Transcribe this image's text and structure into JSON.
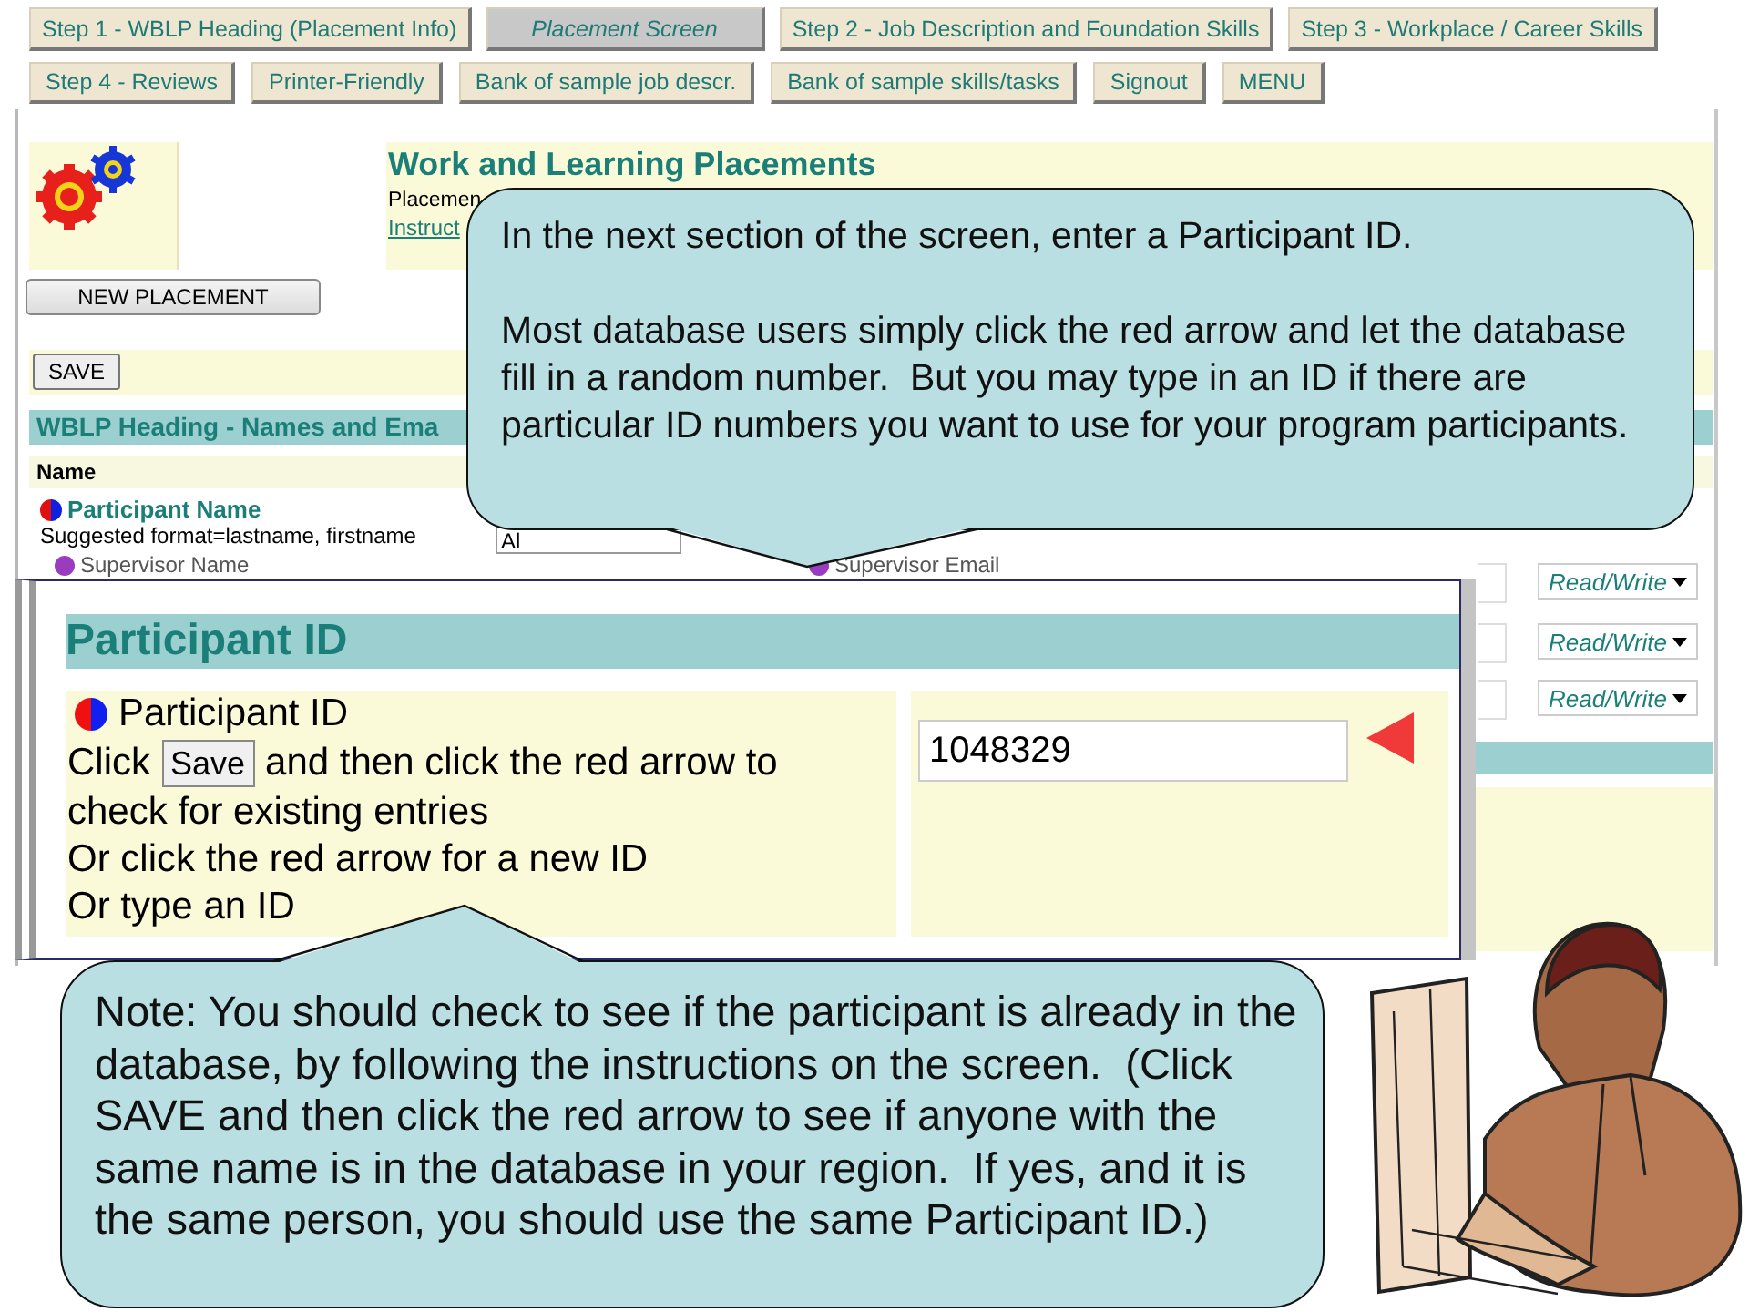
{
  "nav_rows": [
    [
      {
        "label": "Step 1 - WBLP Heading (Placement Info)",
        "selected": false
      },
      {
        "label": "Placement Screen",
        "selected": true
      },
      {
        "label": "Step 2 - Job Description and Foundation Skills",
        "selected": false
      },
      {
        "label": "Step 3 - Workplace / Career Skills",
        "selected": false
      }
    ],
    [
      {
        "label": "Step 4 - Reviews",
        "selected": false
      },
      {
        "label": "Printer-Friendly",
        "selected": false
      },
      {
        "label": "Bank of sample job descr.",
        "selected": false
      },
      {
        "label": "Bank of sample skills/tasks",
        "selected": false
      },
      {
        "label": "Signout",
        "selected": false
      },
      {
        "label": "MENU",
        "selected": false
      }
    ]
  ],
  "header": {
    "title": "Work and Learning Placements",
    "subtitle": "Placemen",
    "link": "Instruct"
  },
  "new_placement_button": "NEW PLACEMENT",
  "save_button": "SAVE",
  "section_heading": "WBLP Heading - Names and Ema",
  "name_column": "Name",
  "participant_name": {
    "label": "Participant Name",
    "hint": "Suggested format=lastname, firstname",
    "value": "Al"
  },
  "supervisor_labels": [
    "Supervisor Name",
    "Supervisor Email"
  ],
  "access_dropdowns": [
    "Read/Write",
    "Read/Write",
    "Read/Write"
  ],
  "inset": {
    "heading": "Participant ID",
    "label": "Participant ID",
    "before": "Click",
    "inline_button": "Save",
    "after": "and then click the red arrow to",
    "lines": [
      "check for existing entries",
      "Or click the red arrow for a new ID",
      "Or type an ID"
    ],
    "id_value": "1048329"
  },
  "callouts": [
    {
      "paragraphs": [
        "In the next section of the screen, enter a Participant ID.",
        "Most database users simply click the red arrow and let the database fill in a random number.  But you may type in an ID if there are particular ID numbers you want to use for your program participants."
      ]
    },
    {
      "paragraphs": [
        "Note: You should check to see if the participant is already in the database, by following the instructions on the screen.  (Click SAVE and then click the red arrow to see if anyone with the same name is in the database in your region.  If yes, and it is the same person, you should use the same Participant ID.)"
      ]
    }
  ]
}
